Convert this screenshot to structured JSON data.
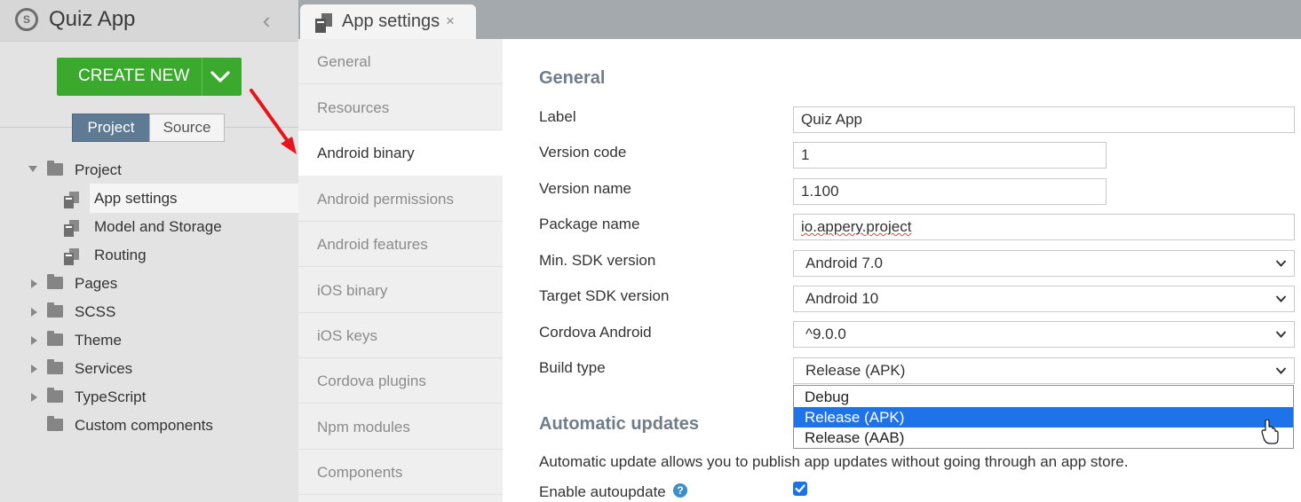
{
  "app": {
    "title": "Quiz App",
    "logo_letter": "S"
  },
  "sidebar": {
    "create_button": "CREATE NEW",
    "toggle": {
      "project": "Project",
      "source": "Source"
    },
    "tree": [
      {
        "label": "Project",
        "type": "folder",
        "expanded": true
      },
      {
        "label": "App settings",
        "type": "file",
        "selected": true
      },
      {
        "label": "Model and Storage",
        "type": "file"
      },
      {
        "label": "Routing",
        "type": "file"
      },
      {
        "label": "Pages",
        "type": "folder",
        "expanded": false
      },
      {
        "label": "SCSS",
        "type": "folder",
        "expanded": false
      },
      {
        "label": "Theme",
        "type": "folder",
        "expanded": false
      },
      {
        "label": "Services",
        "type": "folder",
        "expanded": false
      },
      {
        "label": "TypeScript",
        "type": "folder",
        "expanded": false
      },
      {
        "label": "Custom components",
        "type": "folder"
      }
    ]
  },
  "tab": {
    "label": "App settings",
    "close": "×"
  },
  "nav": {
    "items": [
      "General",
      "Resources",
      "Android binary",
      "Android permissions",
      "Android features",
      "iOS binary",
      "iOS keys",
      "Cordova plugins",
      "Npm modules",
      "Components"
    ],
    "active": "Android binary"
  },
  "form": {
    "general_title": "General",
    "fields": {
      "label": {
        "label": "Label",
        "value": "Quiz App"
      },
      "version_code": {
        "label": "Version code",
        "value": "1"
      },
      "version_name": {
        "label": "Version name",
        "value": "1.100"
      },
      "package_name": {
        "label": "Package name",
        "value": "io.appery.project"
      },
      "min_sdk": {
        "label": "Min. SDK version",
        "value": "Android 7.0"
      },
      "target_sdk": {
        "label": "Target SDK version",
        "value": "Android 10"
      },
      "cordova_android": {
        "label": "Cordova Android",
        "value": "^9.0.0"
      },
      "build_type": {
        "label": "Build type",
        "value": "Release (APK)"
      }
    },
    "build_type_options": [
      "Debug",
      "Release (APK)",
      "Release (AAB)"
    ],
    "build_type_highlighted": "Release (APK)",
    "auto_updates": {
      "title": "Automatic updates",
      "description": "Automatic update allows you to publish app updates without going through an app store.",
      "enable_label": "Enable autoupdate",
      "help": "?",
      "enabled": true
    }
  },
  "colors": {
    "create_button": "#3aa92e",
    "toggle_active": "#5f7b94",
    "dropdown_highlight": "#1e73e8",
    "annotation_arrow": "#e8141b"
  }
}
